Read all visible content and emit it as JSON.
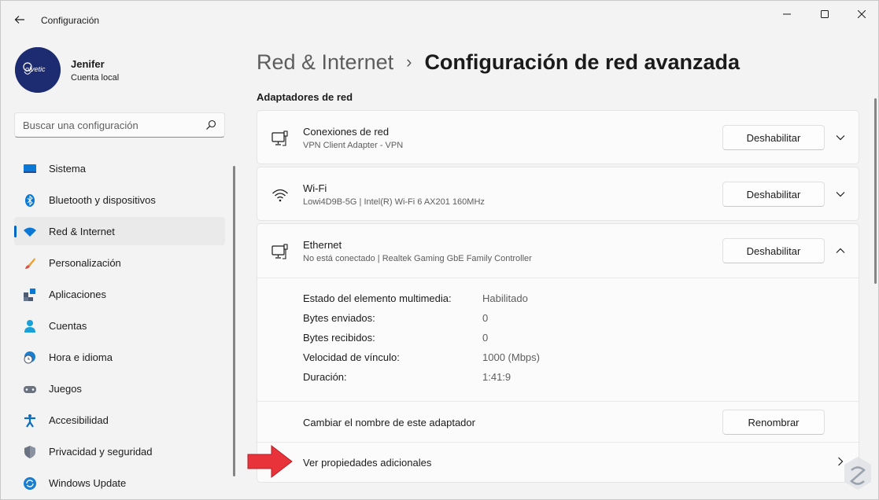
{
  "window": {
    "title": "Configuración",
    "back_icon": "back-arrow-icon"
  },
  "profile": {
    "avatar_text": "olvetic",
    "name": "Jenifer",
    "account_type": "Cuenta local"
  },
  "search": {
    "placeholder": "Buscar una configuración",
    "value": ""
  },
  "nav": {
    "items": [
      {
        "label": "Sistema",
        "icon": "monitor-icon"
      },
      {
        "label": "Bluetooth y dispositivos",
        "icon": "bluetooth-icon"
      },
      {
        "label": "Red & Internet",
        "icon": "wifi-icon",
        "active": true
      },
      {
        "label": "Personalización",
        "icon": "brush-icon"
      },
      {
        "label": "Aplicaciones",
        "icon": "apps-icon"
      },
      {
        "label": "Cuentas",
        "icon": "person-icon"
      },
      {
        "label": "Hora e idioma",
        "icon": "globe-clock-icon"
      },
      {
        "label": "Juegos",
        "icon": "gamepad-icon"
      },
      {
        "label": "Accesibilidad",
        "icon": "accessibility-icon"
      },
      {
        "label": "Privacidad y seguridad",
        "icon": "shield-icon"
      },
      {
        "label": "Windows Update",
        "icon": "update-icon"
      }
    ]
  },
  "breadcrumb": {
    "parent": "Red & Internet",
    "separator": "›",
    "current": "Configuración de red avanzada"
  },
  "section": {
    "title": "Adaptadores de red"
  },
  "adapters": [
    {
      "name": "Conexiones de red",
      "desc": "VPN Client Adapter - VPN",
      "button": "Deshabilitar",
      "expanded": false
    },
    {
      "name": "Wi-Fi",
      "desc": "Lowi4D9B-5G | Intel(R) Wi-Fi 6 AX201 160MHz",
      "button": "Deshabilitar",
      "expanded": false
    },
    {
      "name": "Ethernet",
      "desc": "No está conectado | Realtek Gaming GbE Family Controller",
      "button": "Deshabilitar",
      "expanded": true
    }
  ],
  "ethernet_details": [
    {
      "label": "Estado del elemento multimedia:",
      "value": "Habilitado"
    },
    {
      "label": "Bytes enviados:",
      "value": "0"
    },
    {
      "label": "Bytes recibidos:",
      "value": "0"
    },
    {
      "label": "Velocidad de vínculo:",
      "value": "1000 (Mbps)"
    },
    {
      "label": "Duración:",
      "value": "1:41:9"
    }
  ],
  "rename": {
    "label": "Cambiar el nombre de este adaptador",
    "button": "Renombrar"
  },
  "more_props": {
    "label": "Ver propiedades adicionales"
  },
  "colors": {
    "accent": "#0067c0",
    "annotation_arrow": "#e8333a",
    "background": "#f3f3f3",
    "card": "#fbfbfb"
  }
}
